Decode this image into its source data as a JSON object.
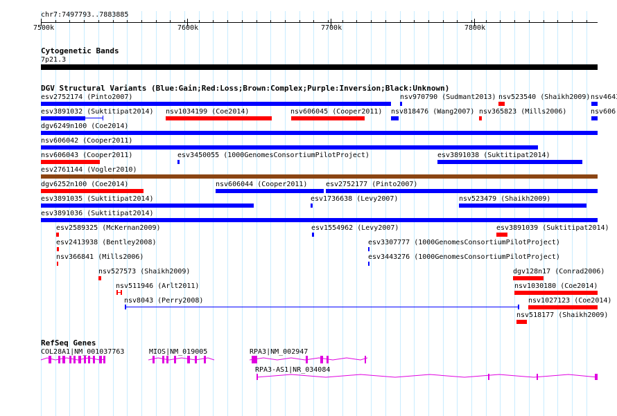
{
  "ruler": {
    "position": "chr7:7497793..7883885",
    "ticks": [
      "7500k",
      "7600k",
      "7700k",
      "7800k"
    ]
  },
  "cytoband": {
    "title": "Cytogenetic Bands",
    "band": "7p21.3"
  },
  "dgv": {
    "title": "DGV Structural Variants (Blue:Gain;Red:Loss;Brown:Complex;Purple:Inversion;Black:Unknown)",
    "labels": [
      "esv2752174 (Pinto2007)",
      "nsv970790 (Sudmant2013)",
      "nsv523540 (Shaikh2009)",
      "nsv4643",
      "esv3891032 (Suktitipat2014)",
      "nsv1034199 (Coe2014)",
      "nsv606045 (Cooper2011)",
      "nsv818476 (Wang2007)",
      "nsv365823 (Mills2006)",
      "nsv606",
      "dgv6249n100 (Coe2014)",
      "nsv606042 (Cooper2011)",
      "nsv606043 (Cooper2011)",
      "esv3450055 (1000GenomesConsortiumPilotProject)",
      "esv3891038 (Suktitipat2014)",
      "esv2761144 (Vogler2010)",
      "dgv6252n100 (Coe2014)",
      "nsv606044 (Cooper2011)",
      "esv2752177 (Pinto2007)",
      "esv3891035 (Suktitipat2014)",
      "esv1736638 (Levy2007)",
      "nsv523479 (Shaikh2009)",
      "esv3891036 (Suktitipat2014)",
      "esv2589325 (McKernan2009)",
      "esv1554962 (Levy2007)",
      "esv3891039 (Suktitipat2014)",
      "esv2413938 (Bentley2008)",
      "esv3307777 (1000GenomesConsortiumPilotProject)",
      "nsv366841 (Mills2006)",
      "esv3443276 (1000GenomesConsortiumPilotProject)",
      "nsv527573 (Shaikh2009)",
      "dgv128n17 (Conrad2006)",
      "nsv511946 (Arlt2011)",
      "nsv1030180 (Coe2014)",
      "nsv8043 (Perry2008)",
      "nsv1027123 (Coe2014)",
      "nsv518177 (Shaikh2009)"
    ]
  },
  "refseq": {
    "title": "RefSeq Genes",
    "genes": [
      "COL28A1|NM_001037763",
      "MIOS|NM_019005",
      "RPA3|NM_002947",
      "RPA3-AS1|NR_034084"
    ]
  },
  "colors": {
    "gain": "#0000ff",
    "loss": "#ff0000",
    "complex": "#8b4513",
    "gene": "#e000e0",
    "grid": "#c8ecff"
  }
}
